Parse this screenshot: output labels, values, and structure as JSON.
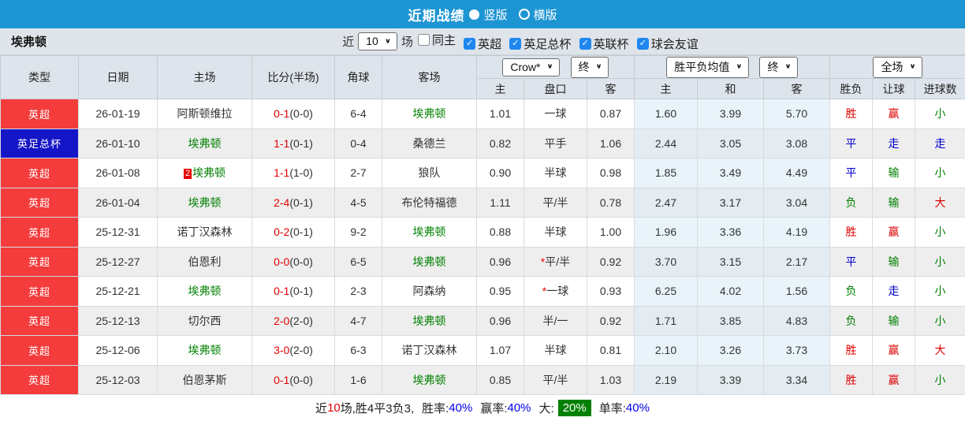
{
  "titlebar": {
    "title": "近期战绩",
    "vertical_label": "竖版",
    "horizontal_label": "横版"
  },
  "filterbar": {
    "team": "埃弗顿",
    "near_label": "近",
    "count_value": "10",
    "games_label": "场",
    "checkboxes": [
      {
        "label": "同主",
        "state": "off"
      },
      {
        "label": "英超",
        "state": "on"
      },
      {
        "label": "英足总杯",
        "state": "on"
      },
      {
        "label": "英联杯",
        "state": "on"
      },
      {
        "label": "球会友谊",
        "state": "on"
      }
    ]
  },
  "header": {
    "selects": {
      "company": "Crow*",
      "company_stage": "终",
      "avg": "胜平负均值",
      "avg_stage": "终",
      "scope": "全场"
    },
    "cols": {
      "type": "类型",
      "date": "日期",
      "home": "主场",
      "score": "比分(半场)",
      "corner": "角球",
      "away": "客场",
      "odds_home": "主",
      "odds_handicap": "盘口",
      "odds_away": "客",
      "avg_home": "主",
      "avg_draw": "和",
      "avg_away": "客",
      "result": "胜负",
      "handicap_result": "让球",
      "goals": "进球数"
    }
  },
  "rows": [
    {
      "league": "英超",
      "lcolor": "bg-red",
      "date": "26-01-19",
      "home": "阿斯顿维拉",
      "hcolor": "t-black",
      "hbadge": "",
      "ft": "0-1",
      "ht": "(0-0)",
      "corner": "6-4",
      "away": "埃弗顿",
      "acolor": "t-green",
      "oh": "1.01",
      "star": "",
      "hcap": "一球",
      "oa": "0.87",
      "ah": "1.60",
      "ad": "3.99",
      "aa": "5.70",
      "r1": "胜",
      "c1": "t-red",
      "r2": "赢",
      "c2": "t-red",
      "r3": "小",
      "c3": "t-green"
    },
    {
      "league": "英足总杯",
      "lcolor": "bg-blue",
      "date": "26-01-10",
      "home": "埃弗顿",
      "hcolor": "t-green",
      "hbadge": "",
      "ft": "1-1",
      "ht": "(0-1)",
      "corner": "0-4",
      "away": "桑德兰",
      "acolor": "t-black",
      "oh": "0.82",
      "star": "",
      "hcap": "平手",
      "oa": "1.06",
      "ah": "2.44",
      "ad": "3.05",
      "aa": "3.08",
      "r1": "平",
      "c1": "t-blue",
      "r2": "走",
      "c2": "t-blue",
      "r3": "走",
      "c3": "t-blue"
    },
    {
      "league": "英超",
      "lcolor": "bg-red",
      "date": "26-01-08",
      "home": "埃弗顿",
      "hcolor": "t-green",
      "hbadge": "2",
      "ft": "1-1",
      "ht": "(1-0)",
      "corner": "2-7",
      "away": "狼队",
      "acolor": "t-black",
      "oh": "0.90",
      "star": "",
      "hcap": "半球",
      "oa": "0.98",
      "ah": "1.85",
      "ad": "3.49",
      "aa": "4.49",
      "r1": "平",
      "c1": "t-blue",
      "r2": "输",
      "c2": "t-green",
      "r3": "小",
      "c3": "t-green"
    },
    {
      "league": "英超",
      "lcolor": "bg-red",
      "date": "26-01-04",
      "home": "埃弗顿",
      "hcolor": "t-green",
      "hbadge": "",
      "ft": "2-4",
      "ht": "(0-1)",
      "corner": "4-5",
      "away": "布伦特福德",
      "acolor": "t-black",
      "oh": "1.11",
      "star": "",
      "hcap": "平/半",
      "oa": "0.78",
      "ah": "2.47",
      "ad": "3.17",
      "aa": "3.04",
      "r1": "负",
      "c1": "t-green",
      "r2": "输",
      "c2": "t-green",
      "r3": "大",
      "c3": "t-red"
    },
    {
      "league": "英超",
      "lcolor": "bg-red",
      "date": "25-12-31",
      "home": "诺丁汉森林",
      "hcolor": "t-black",
      "hbadge": "",
      "ft": "0-2",
      "ht": "(0-1)",
      "corner": "9-2",
      "away": "埃弗顿",
      "acolor": "t-green",
      "oh": "0.88",
      "star": "",
      "hcap": "半球",
      "oa": "1.00",
      "ah": "1.96",
      "ad": "3.36",
      "aa": "4.19",
      "r1": "胜",
      "c1": "t-red",
      "r2": "赢",
      "c2": "t-red",
      "r3": "小",
      "c3": "t-green"
    },
    {
      "league": "英超",
      "lcolor": "bg-red",
      "date": "25-12-27",
      "home": "伯恩利",
      "hcolor": "t-black",
      "hbadge": "",
      "ft": "0-0",
      "ht": "(0-0)",
      "corner": "6-5",
      "away": "埃弗顿",
      "acolor": "t-green",
      "oh": "0.96",
      "star": "*",
      "hcap": "平/半",
      "oa": "0.92",
      "ah": "3.70",
      "ad": "3.15",
      "aa": "2.17",
      "r1": "平",
      "c1": "t-blue",
      "r2": "输",
      "c2": "t-green",
      "r3": "小",
      "c3": "t-green"
    },
    {
      "league": "英超",
      "lcolor": "bg-red",
      "date": "25-12-21",
      "home": "埃弗顿",
      "hcolor": "t-green",
      "hbadge": "",
      "ft": "0-1",
      "ht": "(0-1)",
      "corner": "2-3",
      "away": "阿森纳",
      "acolor": "t-black",
      "oh": "0.95",
      "star": "*",
      "hcap": "一球",
      "oa": "0.93",
      "ah": "6.25",
      "ad": "4.02",
      "aa": "1.56",
      "r1": "负",
      "c1": "t-green",
      "r2": "走",
      "c2": "t-blue",
      "r3": "小",
      "c3": "t-green"
    },
    {
      "league": "英超",
      "lcolor": "bg-red",
      "date": "25-12-13",
      "home": "切尔西",
      "hcolor": "t-black",
      "hbadge": "",
      "ft": "2-0",
      "ht": "(2-0)",
      "corner": "4-7",
      "away": "埃弗顿",
      "acolor": "t-green",
      "oh": "0.96",
      "star": "",
      "hcap": "半/一",
      "oa": "0.92",
      "ah": "1.71",
      "ad": "3.85",
      "aa": "4.83",
      "r1": "负",
      "c1": "t-green",
      "r2": "输",
      "c2": "t-green",
      "r3": "小",
      "c3": "t-green"
    },
    {
      "league": "英超",
      "lcolor": "bg-red",
      "date": "25-12-06",
      "home": "埃弗顿",
      "hcolor": "t-green",
      "hbadge": "",
      "ft": "3-0",
      "ht": "(2-0)",
      "corner": "6-3",
      "away": "诺丁汉森林",
      "acolor": "t-black",
      "oh": "1.07",
      "star": "",
      "hcap": "半球",
      "oa": "0.81",
      "ah": "2.10",
      "ad": "3.26",
      "aa": "3.73",
      "r1": "胜",
      "c1": "t-red",
      "r2": "赢",
      "c2": "t-red",
      "r3": "大",
      "c3": "t-red"
    },
    {
      "league": "英超",
      "lcolor": "bg-red",
      "date": "25-12-03",
      "home": "伯恩茅斯",
      "hcolor": "t-black",
      "hbadge": "",
      "ft": "0-1",
      "ht": "(0-0)",
      "corner": "1-6",
      "away": "埃弗顿",
      "acolor": "t-green",
      "oh": "0.85",
      "star": "",
      "hcap": "平/半",
      "oa": "1.03",
      "ah": "2.19",
      "ad": "3.39",
      "aa": "3.34",
      "r1": "胜",
      "c1": "t-red",
      "r2": "赢",
      "c2": "t-red",
      "r3": "小",
      "c3": "t-green"
    }
  ],
  "summary": {
    "near": "近",
    "count": "10",
    "text": "场,胜4平3负3,",
    "rate1_label": "胜率:",
    "rate1": "40%",
    "rate2_label": "赢率:",
    "rate2": "40%",
    "rate3_label": "大:",
    "rate3": "20%",
    "rate4_label": "单率:",
    "rate4": "40%"
  }
}
